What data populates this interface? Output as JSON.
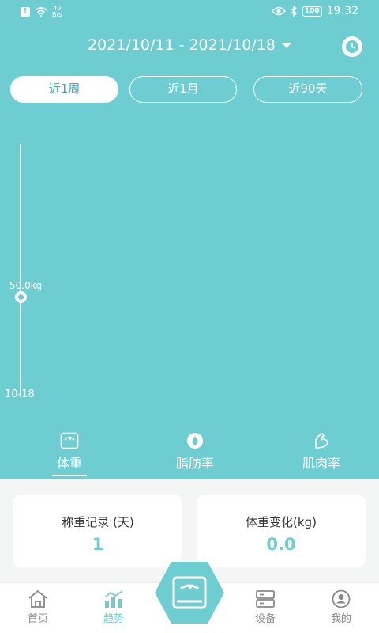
{
  "status_bar": {
    "net_speed_value": "40",
    "net_speed_unit": "B/s",
    "battery": "100",
    "time": "19:32"
  },
  "header": {
    "date_range": "2021/10/11 - 2021/10/18"
  },
  "range_tabs": [
    {
      "label": "近1周",
      "active": true
    },
    {
      "label": "近1月",
      "active": false
    },
    {
      "label": "近90天",
      "active": false
    }
  ],
  "chart_data": {
    "type": "line",
    "x": [
      "10-18"
    ],
    "series": [
      {
        "values": [
          50.0
        ]
      }
    ],
    "point_label": "50.0kg",
    "ylim": [
      0,
      100
    ]
  },
  "metric_tabs": [
    {
      "label": "体重",
      "icon": "scale-icon",
      "active": true
    },
    {
      "label": "脂肪率",
      "icon": "droplet-icon",
      "active": false
    },
    {
      "label": "肌肉率",
      "icon": "muscle-arm-icon",
      "active": false
    }
  ],
  "cards": {
    "weigh_records": {
      "title": "称重记录 (天)",
      "value": "1"
    },
    "weight_change": {
      "title": "体重变化(kg)",
      "value": "0.0"
    }
  },
  "bottom_nav": [
    {
      "label": "首页",
      "icon": "home-icon",
      "active": false
    },
    {
      "label": "趋势",
      "icon": "trend-chart-icon",
      "active": true
    },
    {
      "label": "设备",
      "icon": "device-icon",
      "active": false
    },
    {
      "label": "我的",
      "icon": "profile-icon",
      "active": false
    }
  ],
  "colors": {
    "primary": "#6ecdd0",
    "nav_inactive": "#888888",
    "card_title": "#333333"
  }
}
